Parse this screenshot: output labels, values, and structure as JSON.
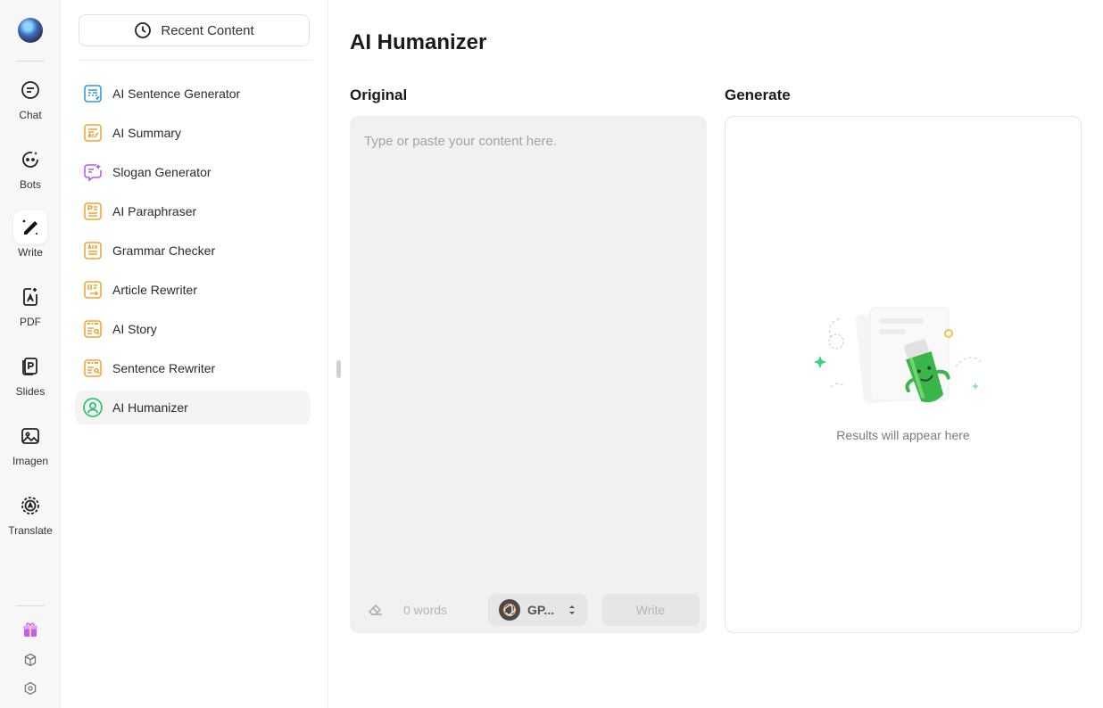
{
  "rail": {
    "items": [
      {
        "label": "Chat",
        "icon": "chat-icon"
      },
      {
        "label": "Bots",
        "icon": "bot-icon"
      },
      {
        "label": "Write",
        "icon": "pen-icon"
      },
      {
        "label": "PDF",
        "icon": "pdf-icon"
      },
      {
        "label": "Slides",
        "icon": "slides-icon"
      },
      {
        "label": "Imagen",
        "icon": "image-icon"
      },
      {
        "label": "Translate",
        "icon": "translate-icon"
      }
    ],
    "active": "Write",
    "bottom_icons": [
      "gift-icon",
      "cube-icon",
      "settings-icon"
    ]
  },
  "panel": {
    "recent_label": "Recent Content",
    "tools": [
      {
        "label": "AI Sentence Generator",
        "icon": "sentence-generator-icon",
        "color": "#2f9be0"
      },
      {
        "label": "AI Summary",
        "icon": "summary-icon",
        "color": "#f0a43a"
      },
      {
        "label": "Slogan Generator",
        "icon": "slogan-icon",
        "color": "#b45be6"
      },
      {
        "label": "AI Paraphraser",
        "icon": "paraphraser-icon",
        "color": "#f0a43a"
      },
      {
        "label": "Grammar Checker",
        "icon": "grammar-icon",
        "color": "#f0a43a"
      },
      {
        "label": "Article Rewriter",
        "icon": "article-rewriter-icon",
        "color": "#f0a43a"
      },
      {
        "label": "AI Story",
        "icon": "story-icon",
        "color": "#f0a43a"
      },
      {
        "label": "Sentence Rewriter",
        "icon": "sentence-rewriter-icon",
        "color": "#f0a43a"
      },
      {
        "label": "AI Humanizer",
        "icon": "humanizer-icon",
        "color": "#2dc26b"
      }
    ],
    "active_tool": "AI Humanizer"
  },
  "main": {
    "title": "AI Humanizer",
    "original": {
      "heading": "Original",
      "placeholder": "Type or paste your content here.",
      "value": "",
      "word_count": "0 words",
      "model": "GP...",
      "write_label": "Write"
    },
    "generate": {
      "heading": "Generate",
      "empty_text": "Results will appear here"
    }
  },
  "colors": {
    "accent_green": "#2dc26b",
    "panel_bg": "#f7f7f8",
    "input_bg": "#f1f1f2"
  }
}
